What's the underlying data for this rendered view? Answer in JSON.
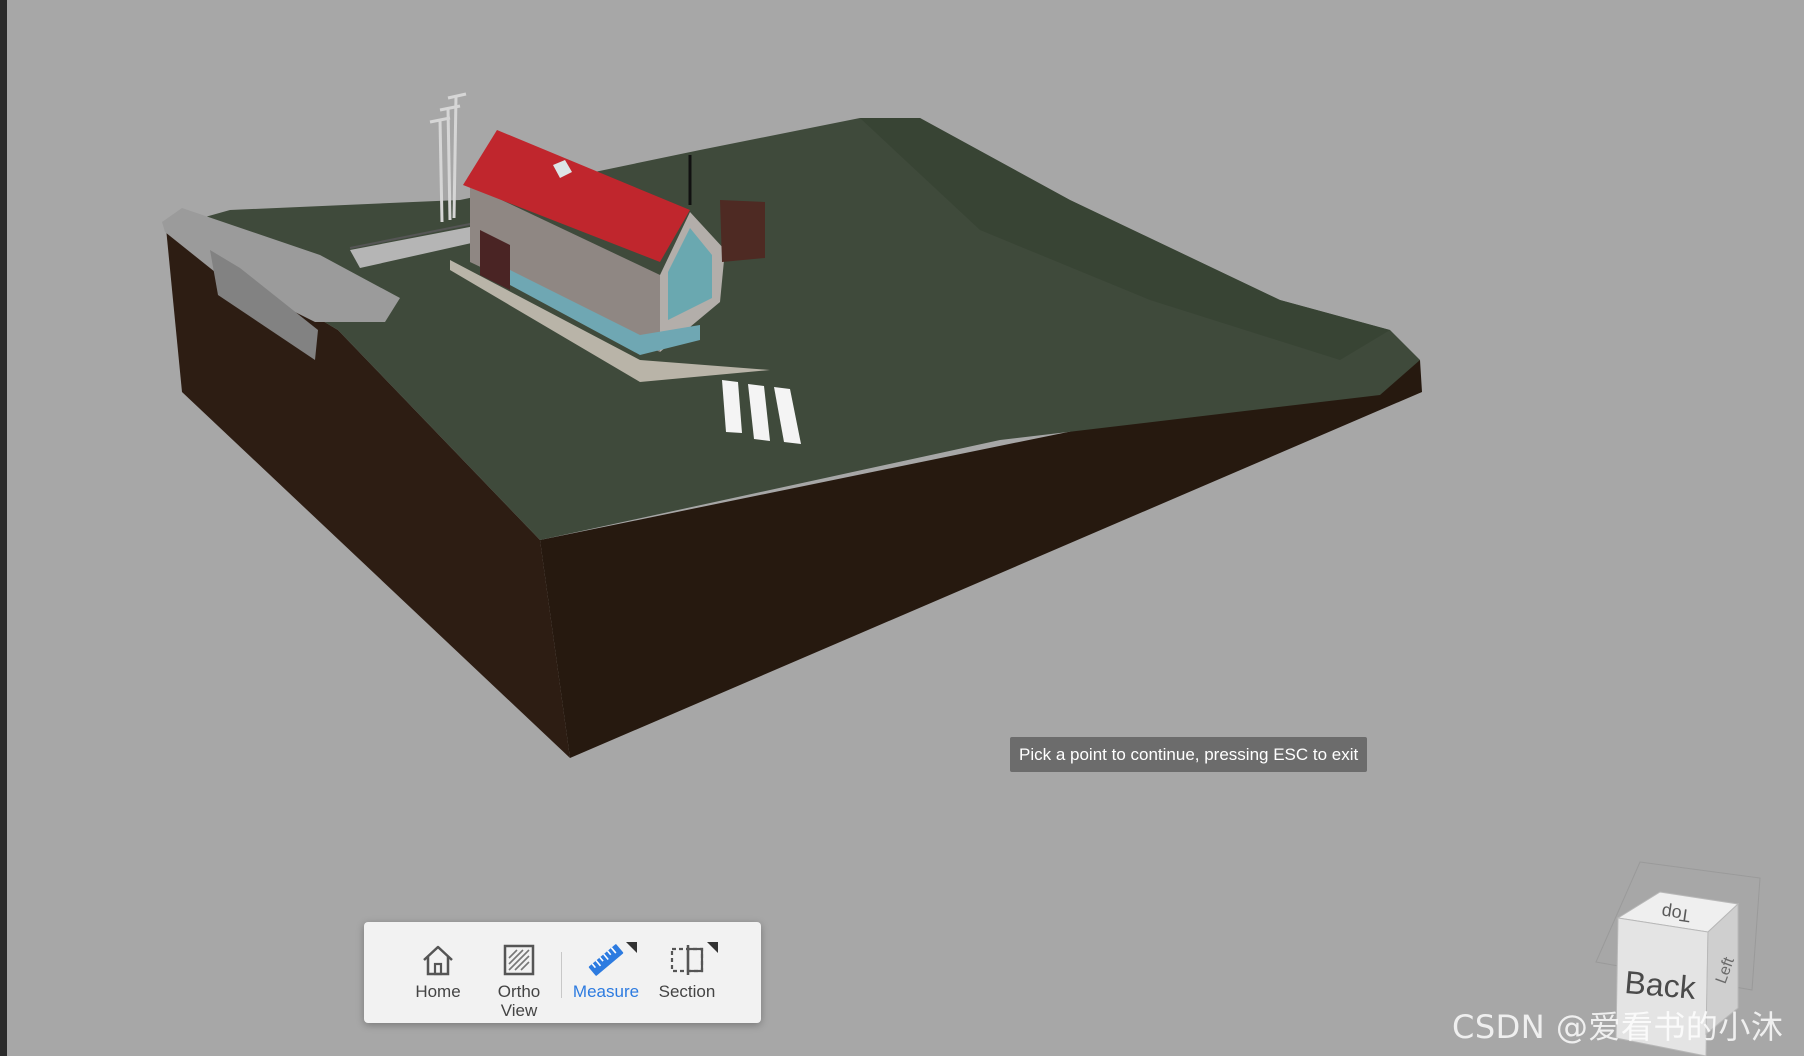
{
  "viewer": {
    "background_color": "#a7a7a7",
    "terrain_top_color": "#3f4a3b",
    "terrain_side_color": "#2a1b12",
    "roof_color": "#c0262d"
  },
  "status": {
    "tooltip_text": "Pick a point to continue, pressing ESC to exit"
  },
  "toolbar": {
    "home_label": "Home",
    "ortho_label_line1": "Ortho",
    "ortho_label_line2": "View",
    "measure_label": "Measure",
    "section_label": "Section",
    "active_tool": "Measure",
    "accent_color": "#2d7be0"
  },
  "viewcube": {
    "top_label": "Top",
    "front_label": "Back",
    "side_label": "Left"
  },
  "watermark": {
    "text": "CSDN @爱看书的小沐"
  }
}
